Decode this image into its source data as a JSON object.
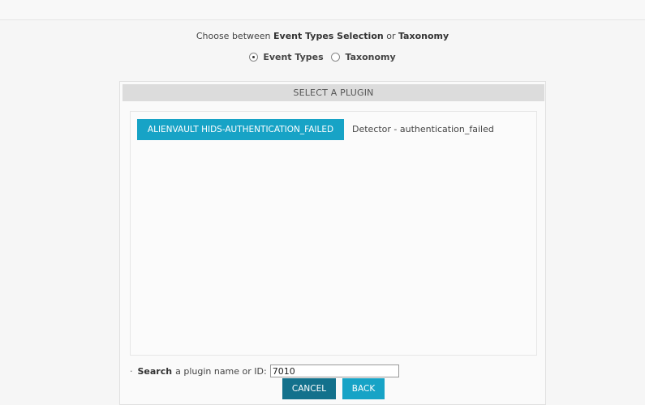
{
  "intro": {
    "prefix": "Choose between ",
    "option_a": "Event Types Selection",
    "connector": " or ",
    "option_b": "Taxonomy"
  },
  "radios": [
    {
      "label": "Event Types",
      "checked": true
    },
    {
      "label": "Taxonomy",
      "checked": false
    }
  ],
  "panel": {
    "header": "SELECT A PLUGIN",
    "plugin_button": "ALIENVAULT HIDS-AUTHENTICATION_FAILED",
    "plugin_description": "Detector - authentication_failed"
  },
  "search": {
    "bullet": "·",
    "label_bold": "Search",
    "label_rest": " a plugin name or ID:",
    "value": "7010"
  },
  "buttons": {
    "cancel": "CANCEL",
    "back": "BACK"
  },
  "colors": {
    "accent": "#17a3c6",
    "accent_dark": "#13718c"
  }
}
